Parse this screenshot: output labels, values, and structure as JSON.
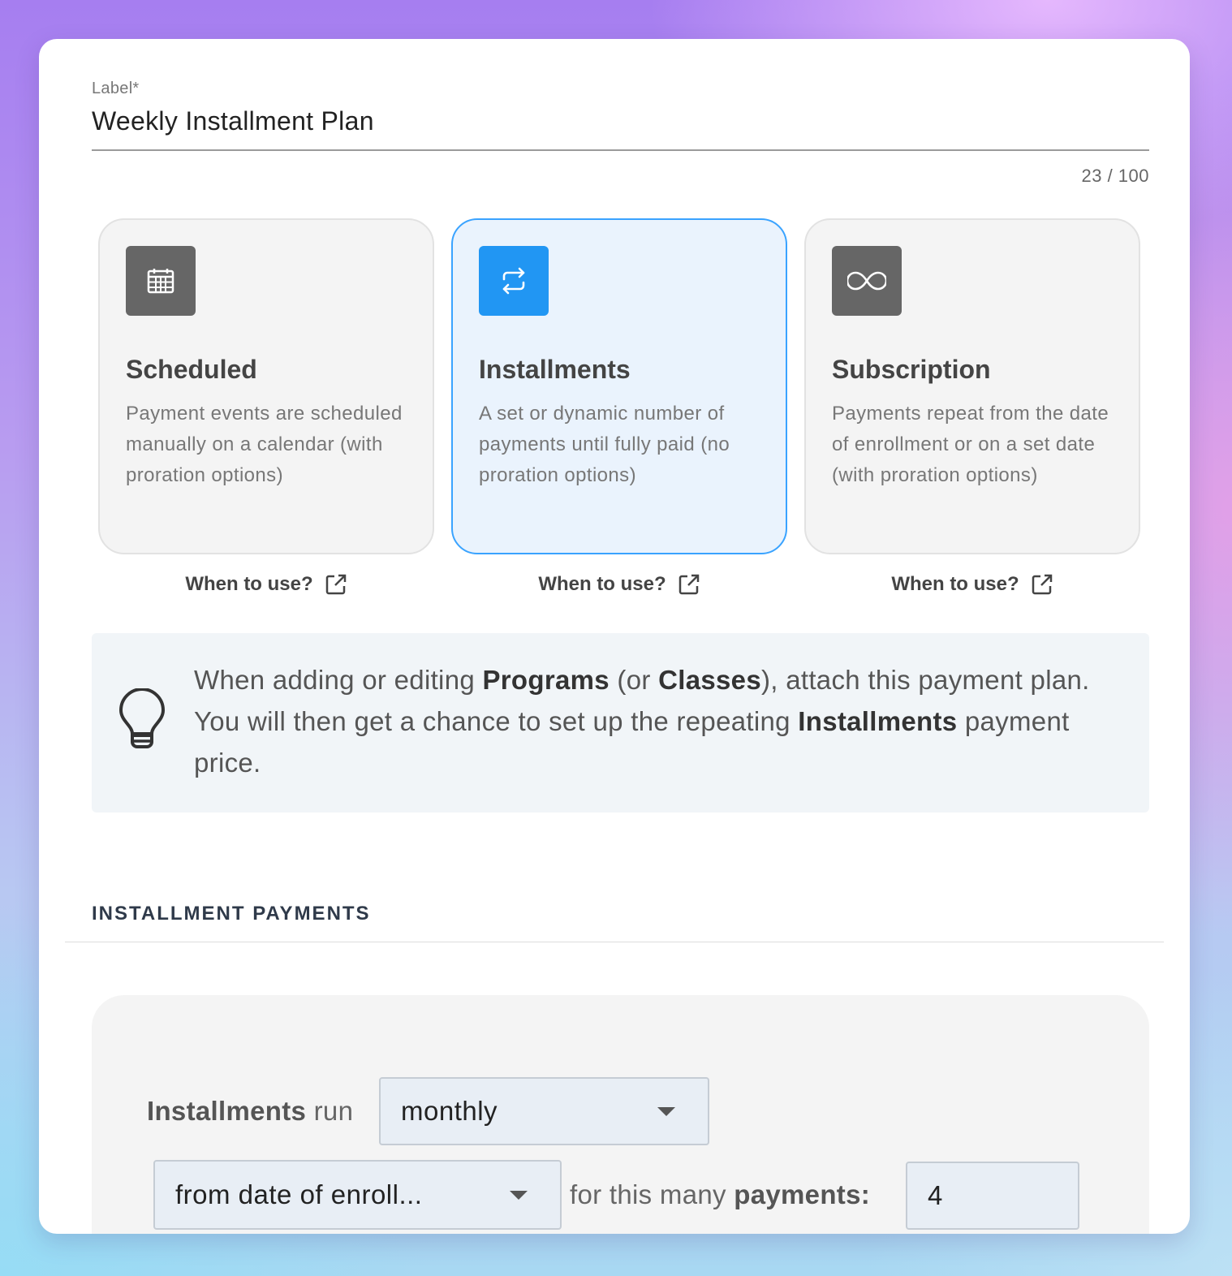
{
  "label_field": {
    "label": "Label*",
    "value": "Weekly Installment Plan",
    "counter": "23 / 100"
  },
  "plan_types": [
    {
      "title": "Scheduled",
      "icon": "calendar-icon",
      "description": "Payment events are scheduled manually on a calendar (with proration options)",
      "link": "When to use?",
      "selected": false
    },
    {
      "title": "Installments",
      "icon": "repeat-icon",
      "description": "A set or dynamic number of payments until fully paid (no proration options)",
      "link": "When to use?",
      "selected": true
    },
    {
      "title": "Subscription",
      "icon": "infinity-icon",
      "description": "Payments repeat from the date of enrollment or on a set date (with proration options)",
      "link": "When to use?",
      "selected": false
    }
  ],
  "tip": {
    "icon": "lightbulb-icon",
    "t1": "When adding or editing ",
    "b1": "Programs",
    "t2": " (or ",
    "b2": "Classes",
    "t3": "), attach this payment plan. You will then get a chance to set up the repeating ",
    "b3": "Installments",
    "t4": " payment price."
  },
  "section": {
    "title": "INSTALLMENT PAYMENTS"
  },
  "installments": {
    "run_bold": "Installments",
    "run_text": "run",
    "frequency": "monthly",
    "start": "from date of enroll...",
    "count_text": "for this many",
    "count_bold": "payments:",
    "count": "4"
  },
  "colors": {
    "accent": "#2196f3",
    "selected_bg": "#eaf3fd",
    "icon_gray": "#666666"
  }
}
